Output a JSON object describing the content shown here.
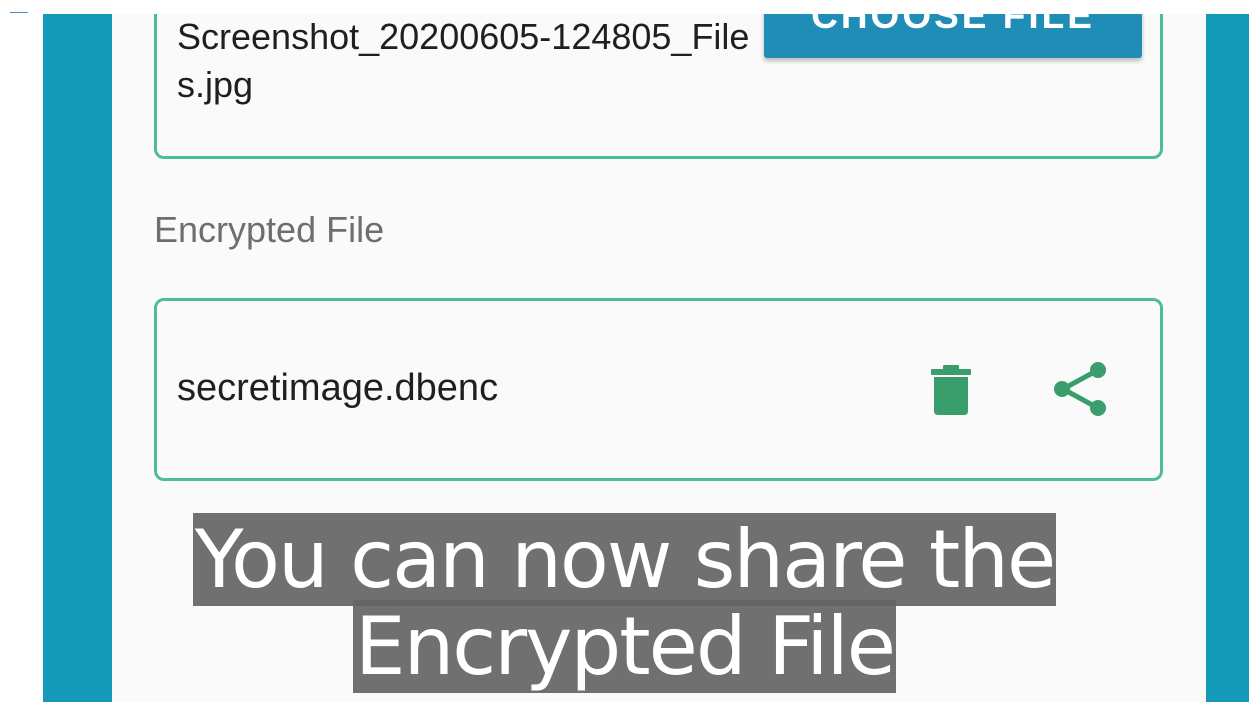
{
  "source_file": {
    "filename": "Screenshot_20200605-124805_Files.jpg",
    "choose_button_label": "CHOOSE FILE"
  },
  "encrypted_section": {
    "label": "Encrypted File",
    "filename": "secretimage.dbenc",
    "actions": [
      {
        "icon": "trash-icon",
        "color": "#3a9e6c"
      },
      {
        "icon": "share-icon",
        "color": "#3a9e6c"
      }
    ]
  },
  "caption": {
    "line1": "You can now share the",
    "line2": "Encrypted File"
  },
  "colors": {
    "side_band": "#1599b8",
    "button": "#1f8db5",
    "border": "#4dbd95",
    "icon": "#3a9e6c"
  }
}
